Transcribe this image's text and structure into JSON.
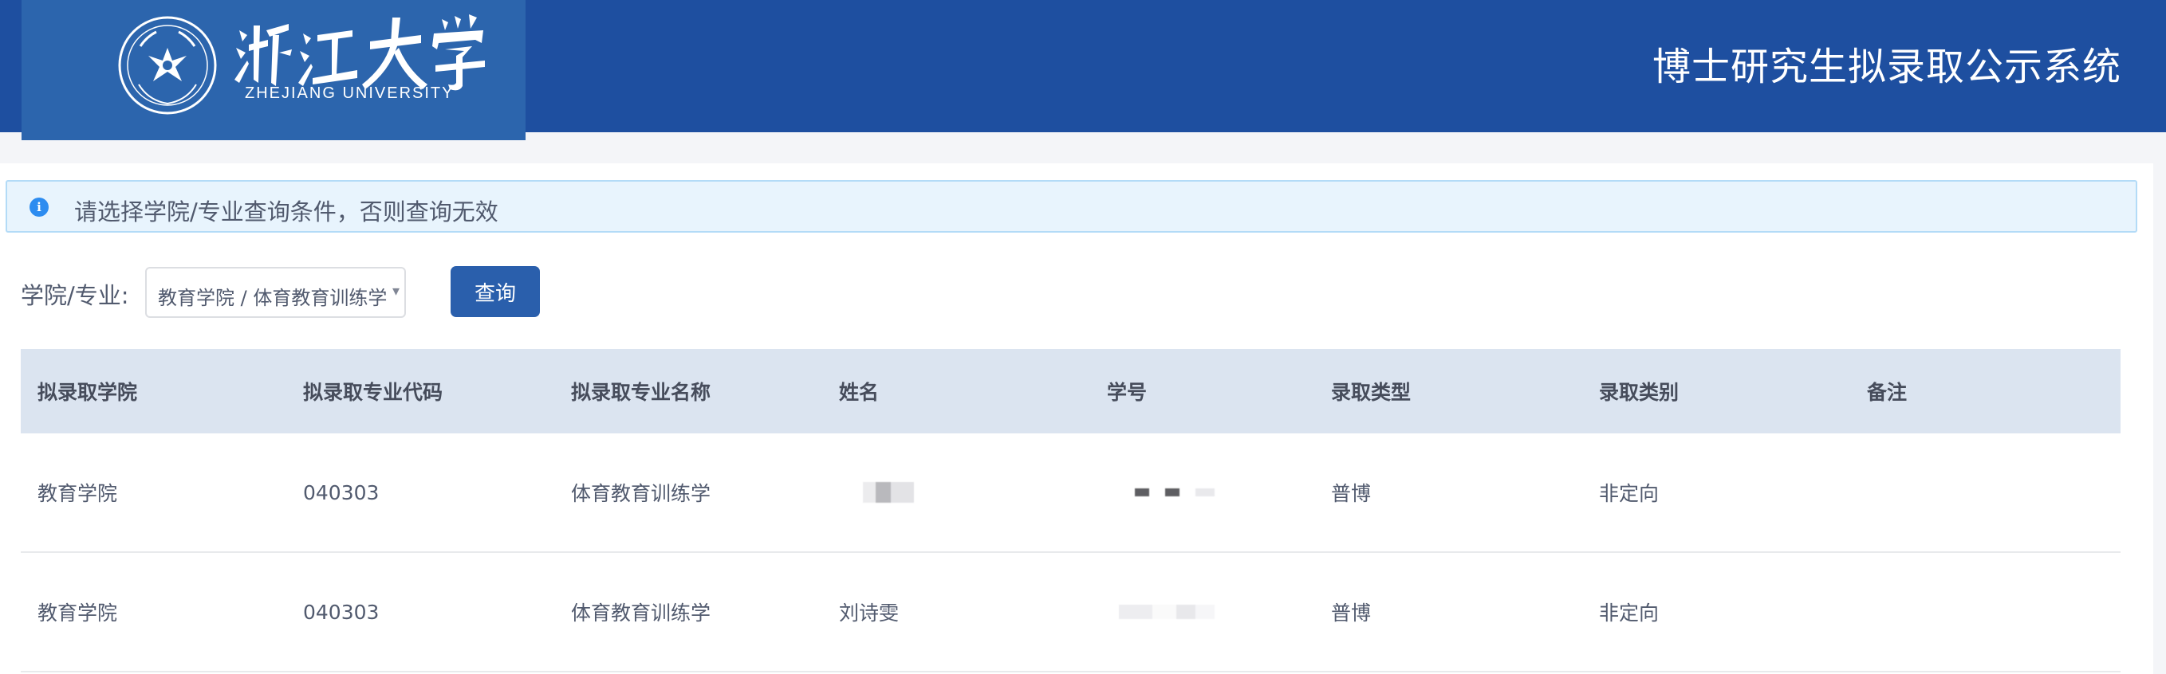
{
  "header": {
    "logo_en": "ZHEJIANG UNIVERSITY",
    "title": "博士研究生拟录取公示系统",
    "logo_cn": "浙江大学"
  },
  "notice": {
    "icon": "info-icon",
    "text": "请选择学院/专业查询条件，否则查询无效"
  },
  "filter": {
    "label": "学院/专业:",
    "selected": "教育学院 / 体育教育训练学",
    "button_label": "查询"
  },
  "table": {
    "columns": [
      "拟录取学院",
      "拟录取专业代码",
      "拟录取专业名称",
      "姓名",
      "学号",
      "录取类型",
      "录取类别",
      "备注"
    ],
    "rows": [
      {
        "college": "教育学院",
        "code": "040303",
        "major": "体育教育训练学",
        "name": "",
        "student_id": "",
        "type": "普博",
        "category": "非定向",
        "note": ""
      },
      {
        "college": "教育学院",
        "code": "040303",
        "major": "体育教育训练学",
        "name": "刘诗雯",
        "student_id": "",
        "type": "普博",
        "category": "非定向",
        "note": ""
      }
    ]
  },
  "colors": {
    "header_bg": "#1e4fa0",
    "logo_bg": "#2c65ad",
    "button_bg": "#2a5fac",
    "table_head_bg": "#dbe4f0",
    "notice_bg": "#e8f4fd"
  }
}
